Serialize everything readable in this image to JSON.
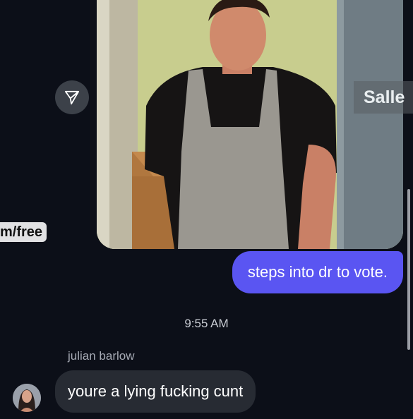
{
  "conversation": {
    "media_message": {
      "overlay_left_text": "m/free",
      "overlay_right_text": "Salle",
      "share_icon": "send-icon"
    },
    "outgoing_message": {
      "text": "steps into dr to vote."
    },
    "timestamp": "9:55 AM",
    "incoming_message": {
      "sender_name": "julian barlow",
      "text": "youre a lying fucking cunt",
      "avatar": "avatar-photo"
    }
  },
  "colors": {
    "background": "#0c0f18",
    "outgoing_bubble": "#5a55f2",
    "incoming_bubble": "#272b33",
    "share_button": "#3c4149"
  }
}
